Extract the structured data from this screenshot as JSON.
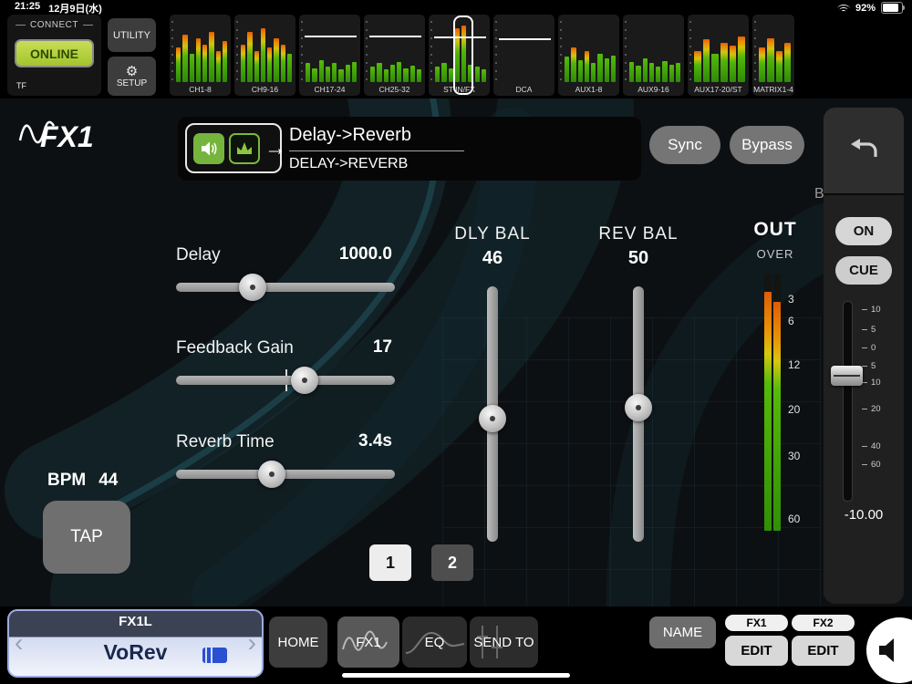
{
  "status_bar": {
    "time": "21:25",
    "date": "12月9日(水)",
    "battery_percent": "92%"
  },
  "connect_panel": {
    "title": "CONNECT",
    "online_button": "ONLINE",
    "device_label": "TF"
  },
  "top_buttons": {
    "utility": "UTILITY",
    "setup": "SETUP"
  },
  "icons": {
    "arrow_right": "→",
    "gear": "⚙",
    "chevron_left": "‹",
    "chevron_right": "›"
  },
  "meter_bridge": {
    "strips": [
      {
        "label": "CH1-8",
        "bars": [
          0.55,
          0.75,
          0.45,
          0.7,
          0.6,
          0.8,
          0.5,
          0.65
        ]
      },
      {
        "label": "CH9-16",
        "bars": [
          0.6,
          0.8,
          0.5,
          0.85,
          0.55,
          0.7,
          0.6,
          0.45
        ]
      },
      {
        "label": "CH17-24",
        "bars": [
          0.3,
          0.22,
          0.35,
          0.25,
          0.3,
          0.2,
          0.28,
          0.32
        ],
        "fader_line": 0.26
      },
      {
        "label": "CH25-32",
        "bars": [
          0.25,
          0.3,
          0.2,
          0.28,
          0.32,
          0.22,
          0.26,
          0.2
        ],
        "fader_line": 0.26
      },
      {
        "label": "ST IN/FX",
        "bars": [
          0.25,
          0.3,
          0.22,
          0.85,
          0.9,
          0.28,
          0.24,
          0.2
        ],
        "fader_line": 0.28,
        "selected": true
      },
      {
        "label": "DCA",
        "bars": [
          0,
          0,
          0,
          0,
          0,
          0,
          0,
          0
        ],
        "fader_line": 0.3
      },
      {
        "label": "AUX1-8",
        "bars": [
          0.4,
          0.55,
          0.35,
          0.5,
          0.3,
          0.45,
          0.38,
          0.42
        ]
      },
      {
        "label": "AUX9-16",
        "bars": [
          0.32,
          0.26,
          0.38,
          0.3,
          0.24,
          0.34,
          0.28,
          0.3
        ]
      },
      {
        "label": "AUX17-20/ST",
        "bars": [
          0.5,
          0.68,
          0.45,
          0.62,
          0.58,
          0.72
        ]
      },
      {
        "label": "MATRIX1-4",
        "bars": [
          0.55,
          0.7,
          0.5,
          0.62
        ],
        "narrow": true
      }
    ]
  },
  "fx_header": {
    "logo": "FX1",
    "title": "Delay->Reverb",
    "subtitle": "DELAY->REVERB",
    "sync_button": "Sync",
    "bypass_button": "Bypass",
    "bpm_label": "BPM",
    "bpm_value": "44"
  },
  "parameters": {
    "delay": {
      "label": "Delay",
      "value": "1000.0",
      "pos": 0.33
    },
    "feedback_gain": {
      "label": "Feedback Gain",
      "value": "17",
      "pos": 0.6
    },
    "reverb_time": {
      "label": "Reverb Time",
      "value": "3.4s",
      "pos": 0.43
    },
    "dly_bal": {
      "label": "DLY BAL",
      "value": "46",
      "pos": 0.52
    },
    "rev_bal": {
      "label": "REV BAL",
      "value": "50",
      "pos": 0.47
    }
  },
  "out_meter": {
    "label": "OUT",
    "over_label": "OVER",
    "levels": [
      0.93,
      0.89
    ],
    "scale": [
      {
        "text": "3",
        "pos": 0.1
      },
      {
        "text": "6",
        "pos": 0.185
      },
      {
        "text": "12",
        "pos": 0.355
      },
      {
        "text": "20",
        "pos": 0.53
      },
      {
        "text": "30",
        "pos": 0.71
      },
      {
        "text": "60",
        "pos": 0.955
      }
    ]
  },
  "tap_section": {
    "bpm_label": "BPM",
    "bpm_value": "44",
    "tap_button": "TAP"
  },
  "pages": [
    {
      "label": "1",
      "active": true
    },
    {
      "label": "2",
      "active": false
    }
  ],
  "channel_panel": {
    "on_button": "ON",
    "cue_button": "CUE",
    "fader_value": "-10.00",
    "fader_pos": 0.36,
    "fader_scale": [
      {
        "text": "10",
        "pos": 0.02
      },
      {
        "text": "5",
        "pos": 0.13
      },
      {
        "text": "0",
        "pos": 0.23
      },
      {
        "text": "5",
        "pos": 0.33
      },
      {
        "text": "10",
        "pos": 0.42
      },
      {
        "text": "20",
        "pos": 0.565
      },
      {
        "text": "40",
        "pos": 0.77
      },
      {
        "text": "60",
        "pos": 0.87
      }
    ]
  },
  "bottom_bar": {
    "channel_select": {
      "id": "FX1L",
      "name": "VoRev"
    },
    "home_button": "HOME",
    "tabs": [
      {
        "label": "FX1",
        "active": true,
        "icon": "wave"
      },
      {
        "label": "EQ",
        "active": false,
        "icon": "eq"
      },
      {
        "label": "SEND TO",
        "active": false,
        "icon": "fader"
      }
    ],
    "name_button": "NAME",
    "fx_slots": [
      {
        "label": "FX1",
        "edit": "EDIT"
      },
      {
        "label": "FX2",
        "edit": "EDIT"
      }
    ]
  }
}
